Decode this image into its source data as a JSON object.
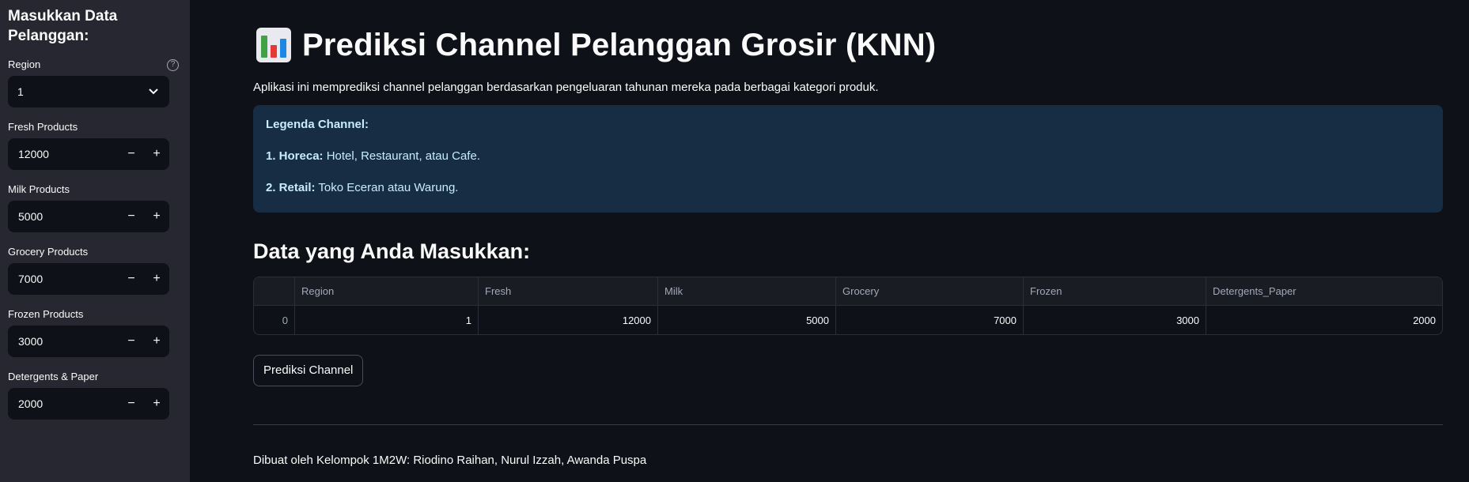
{
  "sidebar": {
    "title": "Masukkan Data Pelanggan:",
    "region": {
      "label": "Region",
      "value": "1"
    },
    "inputs": [
      {
        "label": "Fresh Products",
        "value": "12000"
      },
      {
        "label": "Milk Products",
        "value": "5000"
      },
      {
        "label": "Grocery Products",
        "value": "7000"
      },
      {
        "label": "Frozen Products",
        "value": "3000"
      },
      {
        "label": "Detergents & Paper",
        "value": "2000"
      }
    ],
    "minus": "−",
    "plus": "+"
  },
  "main": {
    "title": "Prediksi Channel Pelanggan Grosir (KNN)",
    "description": "Aplikasi ini memprediksi channel pelanggan berdasarkan pengeluaran tahunan mereka pada berbagai kategori produk.",
    "legend": {
      "heading": "Legenda Channel:",
      "item1_key": "1. Horeca:",
      "item1_text": " Hotel, Restaurant, atau Cafe.",
      "item2_key": "2. Retail:",
      "item2_text": " Toko Eceran atau Warung."
    },
    "section_title": "Data yang Anda Masukkan:",
    "table": {
      "columns": [
        "",
        "Region",
        "Fresh",
        "Milk",
        "Grocery",
        "Frozen",
        "Detergents_Paper"
      ],
      "rows": [
        [
          "0",
          "1",
          "12000",
          "5000",
          "7000",
          "3000",
          "2000"
        ]
      ]
    },
    "predict_button": "Prediksi Channel",
    "footer": "Dibuat oleh Kelompok 1M2W: Riodino Raihan, Nurul Izzah, Awanda Puspa"
  },
  "colors": {
    "background": "#0e1117",
    "sidebar": "#262730",
    "info_box": "#172d43",
    "info_text": "#c7ebff"
  }
}
